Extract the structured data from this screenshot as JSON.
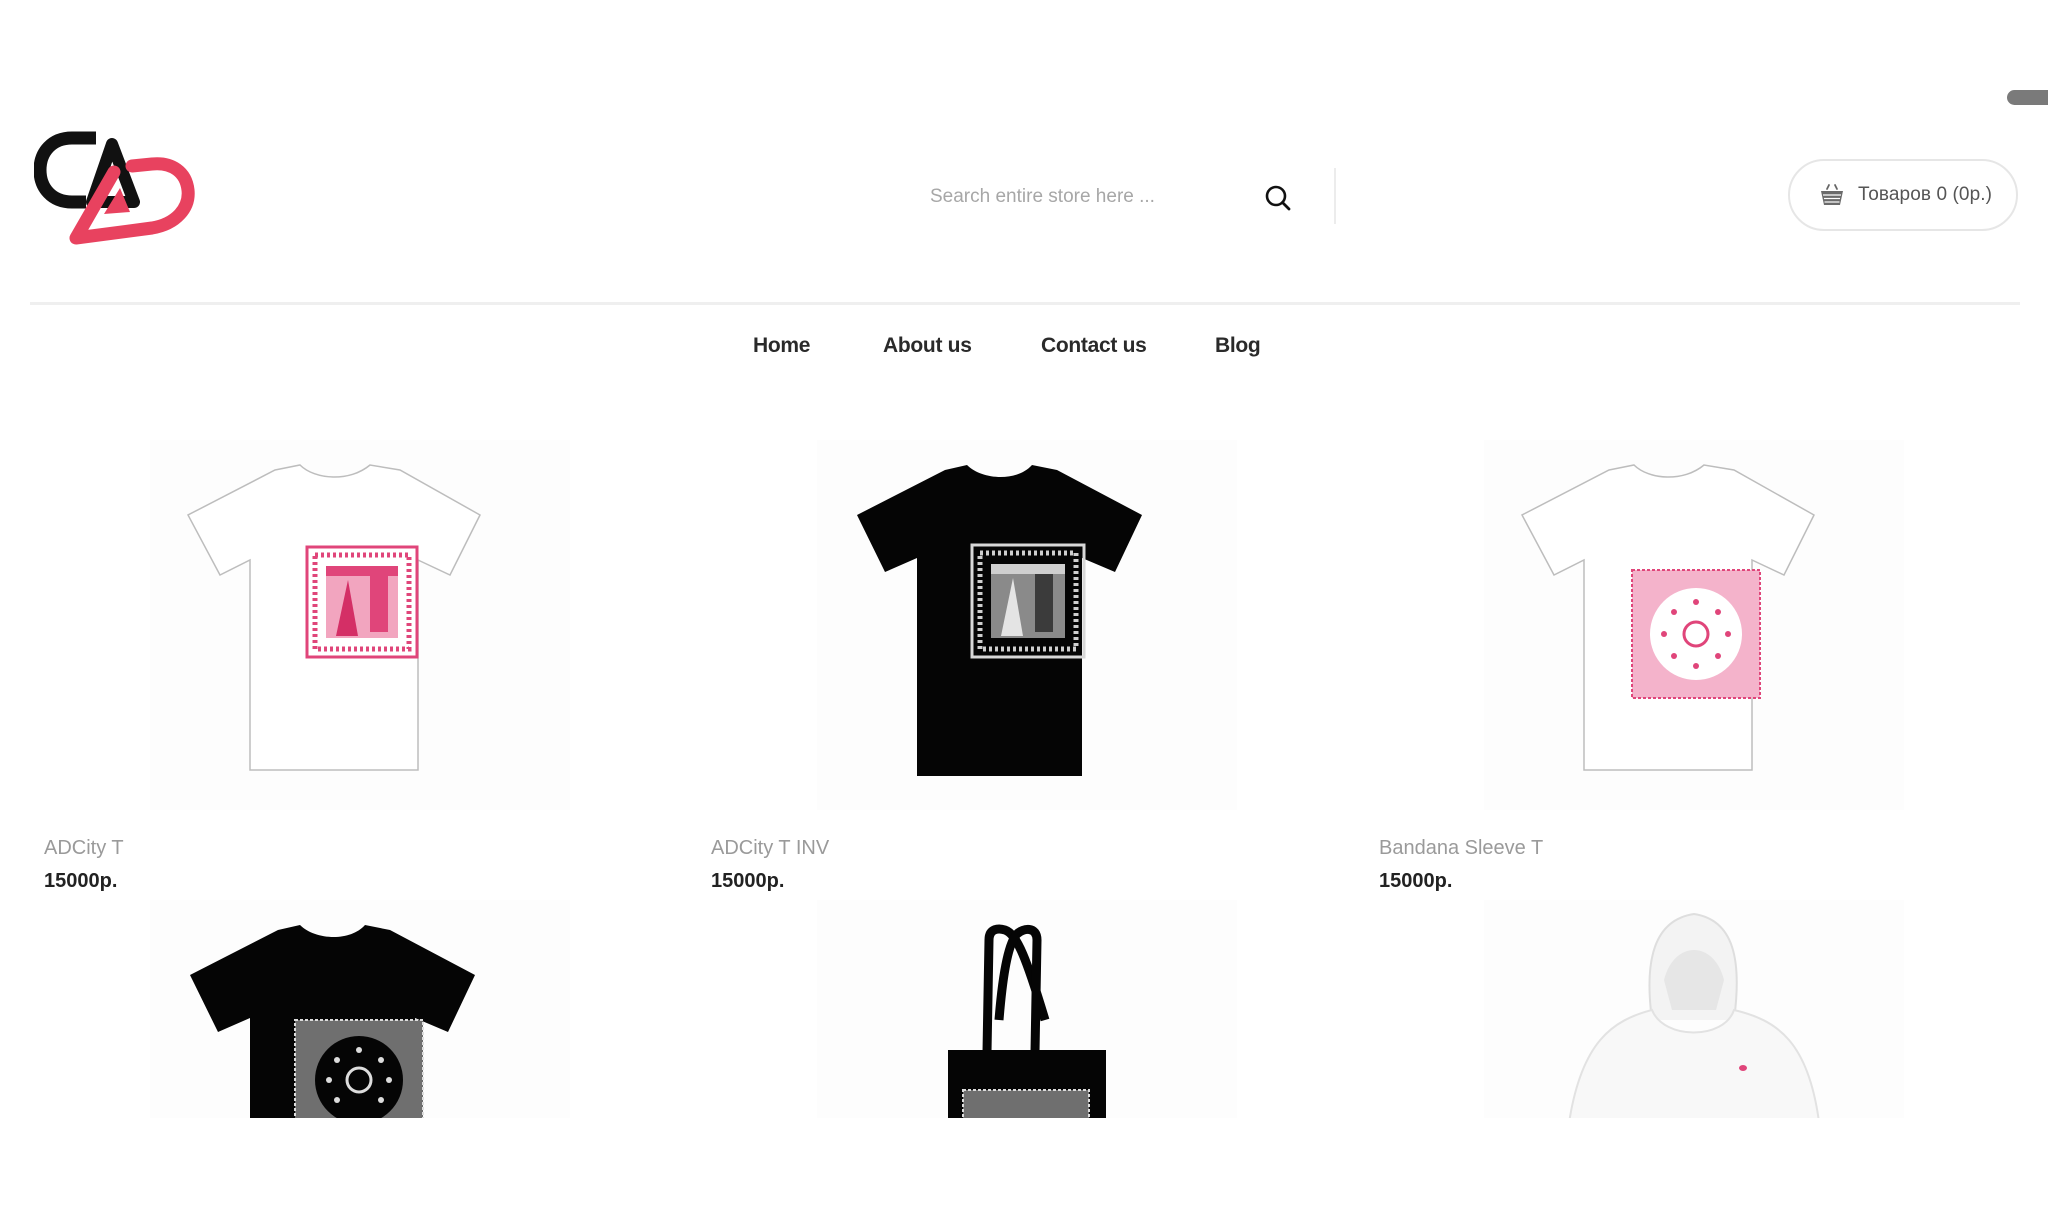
{
  "header": {
    "logo_alt": "CAD logo",
    "search": {
      "placeholder": "Search entire store here ...",
      "value": ""
    },
    "cart": {
      "label": "Товаров 0 (0р.)",
      "count": 0,
      "total": "0р."
    }
  },
  "nav": {
    "items": [
      {
        "label": "Home"
      },
      {
        "label": "About us"
      },
      {
        "label": "Contact us"
      },
      {
        "label": "Blog"
      }
    ]
  },
  "colors": {
    "brand_pink": "#e8425f",
    "brand_black": "#111111",
    "print_pink": "#e0457a",
    "text_muted": "#9a9a9a"
  },
  "products": [
    {
      "name": "ADCity T",
      "price": "15000р.",
      "image": "white-tshirt-pink-print"
    },
    {
      "name": "ADCity T INV",
      "price": "15000р.",
      "image": "black-tshirt-white-print"
    },
    {
      "name": "Bandana Sleeve T",
      "price": "15000р.",
      "image": "white-tshirt-pink-bandana"
    },
    {
      "name": "",
      "price": "",
      "image": "black-tshirt-bandana"
    },
    {
      "name": "",
      "price": "",
      "image": "black-tote-bag-bandana"
    },
    {
      "name": "",
      "price": "",
      "image": "white-hoodie"
    }
  ]
}
